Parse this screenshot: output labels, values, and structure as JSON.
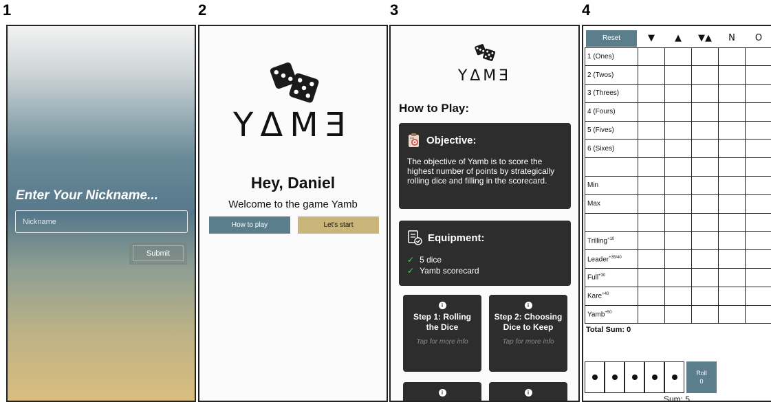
{
  "panel_labels": [
    "1",
    "2",
    "3",
    "4"
  ],
  "screen1": {
    "title": "Enter Your Nickname...",
    "nickname_placeholder": "Nickname",
    "submit_label": "Submit"
  },
  "screen2": {
    "logo": "YΔMƎ",
    "greeting": "Hey, Daniel",
    "welcome": "Welcome to the game Yamb",
    "how_to_play_label": "How to play",
    "start_label": "Let's start"
  },
  "screen3": {
    "logo": "YΔMƎ",
    "heading": "How to Play:",
    "objective": {
      "title": "Objective:",
      "text": "The objective of Yamb is to score the highest number of points by strategically rolling dice and filling in the scorecard."
    },
    "equipment": {
      "title": "Equipment:",
      "items": [
        "5 dice",
        "Yamb scorecard"
      ]
    },
    "steps": [
      {
        "title": "Step 1: Rolling the Dice",
        "hint": "Tap for more info"
      },
      {
        "title": "Step 2: Choosing Dice to Keep",
        "hint": "Tap for more info"
      }
    ]
  },
  "screen4": {
    "reset_label": "Reset",
    "columns": [
      "▼",
      "▲",
      "▼▲",
      "N",
      "O"
    ],
    "rows": [
      "1 (Ones)",
      "2 (Twos)",
      "3 (Threes)",
      "4 (Fours)",
      "5 (Fives)",
      "6 (Sixes)",
      "",
      "Min",
      "Max",
      "",
      "Trilling",
      "Leader",
      "Full",
      "Kare",
      "Yamb"
    ],
    "row_bonuses": {
      "Trilling": "+10",
      "Leader": "+35/40",
      "Full": "+30",
      "Kare": "+40",
      "Yamb": "+50"
    },
    "total_label": "Total Sum: 0",
    "roll_label": "Roll",
    "roll_count": "0",
    "sum_label": "Sum: 5",
    "dice_count": 5
  },
  "colors": {
    "accent": "#5b7e8c",
    "gold": "#c9b57a",
    "card": "#2d2d2d",
    "check": "#4cd964"
  }
}
